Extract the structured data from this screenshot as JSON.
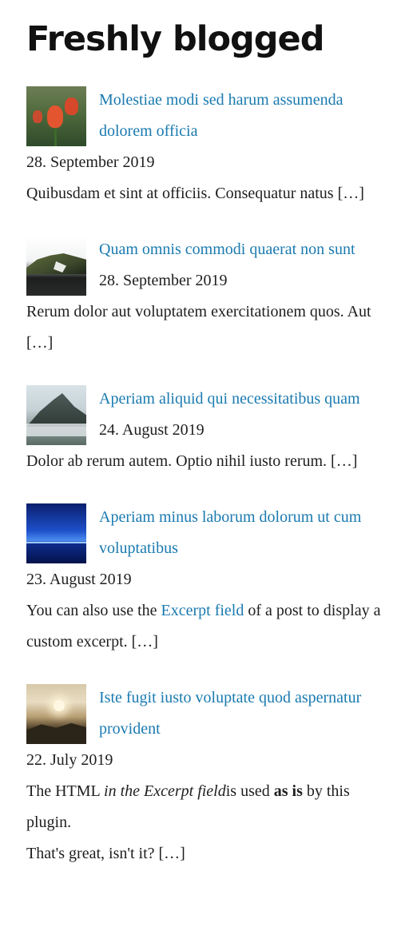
{
  "widget": {
    "title": "Freshly blogged"
  },
  "posts": [
    {
      "title": "Molestiae modi sed harum assumenda dolorem officia",
      "date": "28. September 2019",
      "excerpt": "Quibusdam et sint at officiis. Consequatur natus […]",
      "thumb_icon": "tulip-photo"
    },
    {
      "title": "Quam omnis commodi quaerat non sunt",
      "date": "28. September 2019",
      "excerpt": "Rerum dolor aut voluptatem exercitationem quos. Aut […]",
      "thumb_icon": "snowy-hill-photo"
    },
    {
      "title": "Aperiam aliquid qui necessitatibus quam",
      "date": "24. August 2019",
      "excerpt": "Dolor ab rerum autem. Optio nihil iusto rerum. […]",
      "thumb_icon": "misty-mountain-photo"
    },
    {
      "title": "Aperiam minus laborum dolorum ut cum voluptatibus",
      "date": "23. August 2019",
      "excerpt_before": "You can also use the ",
      "excerpt_link": "Excerpt field",
      "excerpt_after": " of a post to display a custom excerpt. […]",
      "thumb_icon": "blue-sea-photo"
    },
    {
      "title": "Iste fugit iusto voluptate quod aspernatur provident",
      "date": "22. July 2019",
      "excerpt_part1": "The HTML ",
      "excerpt_italic": "in the Excerpt field",
      "excerpt_part2": "is used ",
      "excerpt_bold": "as is",
      "excerpt_part3": " by this plugin.",
      "excerpt_line2": "That's great, isn't it? […]",
      "thumb_icon": "sunset-photo"
    }
  ],
  "colors": {
    "link": "#1a7ab0",
    "text": "#1e1e1e",
    "title": "#111111"
  }
}
